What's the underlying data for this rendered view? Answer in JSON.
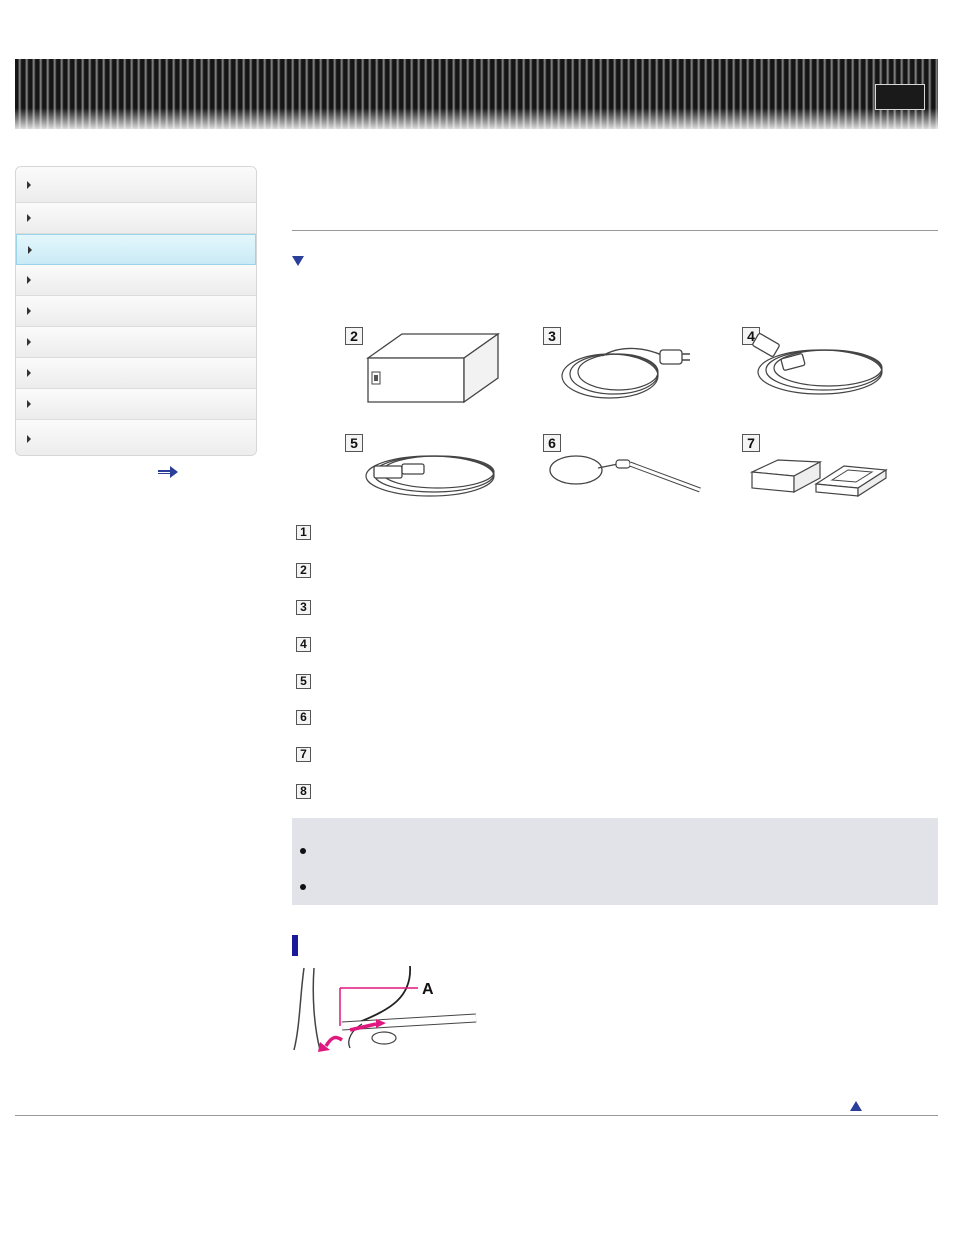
{
  "sidebar": {
    "items": [
      {
        "label": ""
      },
      {
        "label": ""
      },
      {
        "label": "",
        "active": true
      },
      {
        "label": ""
      },
      {
        "label": ""
      },
      {
        "label": ""
      },
      {
        "label": ""
      },
      {
        "label": ""
      },
      {
        "label": ""
      }
    ]
  },
  "icons": {
    "banner_button": "square-button",
    "section_toggle": "triangle-down-icon",
    "back_to_top": "triangle-up-icon",
    "more_link": "arrow-right-icon"
  },
  "accessories_grid": [
    {
      "number": "2",
      "item": "ac-adaptor"
    },
    {
      "number": "3",
      "item": "power-cord"
    },
    {
      "number": "4",
      "item": "hdmi-cable"
    },
    {
      "number": "5",
      "item": "usb-cable"
    },
    {
      "number": "6",
      "item": "wrist-strap"
    },
    {
      "number": "7",
      "item": "battery-pack-and-case"
    }
  ],
  "item_list": [
    "1",
    "2",
    "3",
    "4",
    "5",
    "6",
    "7",
    "8"
  ],
  "strap_diagram": {
    "callout": "A"
  },
  "colors": {
    "accent_blue": "#2a3f9a",
    "section_bar": "#1a1a9a",
    "note_bg": "#e1e3e8",
    "active_sidebar": "#c9eaf5",
    "callout_magenta": "#e0177f"
  }
}
